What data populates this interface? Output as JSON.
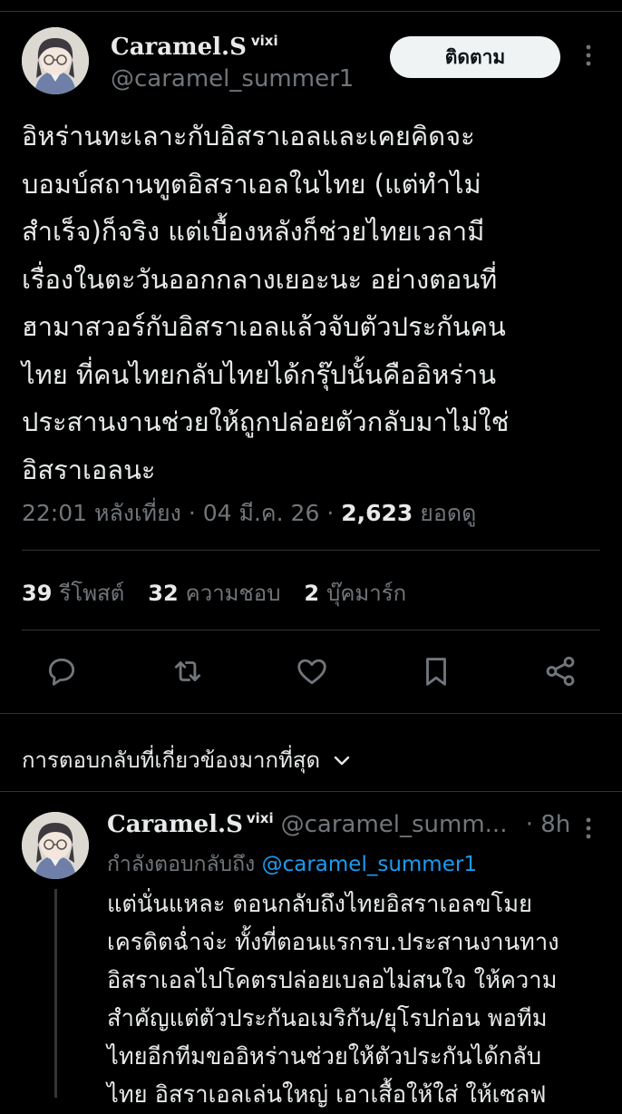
{
  "top_cut_text": "· · ·",
  "post": {
    "author": {
      "name": "Caramel.S",
      "name_suffix": "vixi",
      "handle": "@caramel_summer1"
    },
    "follow_label": "ติดตาม",
    "more_icon": "more-icon",
    "text": "อิหร่านทะเลาะกับอิสราเอลและเคยคิดจะ\nบอมบ์สถานทูตอิสราเอลในไทย (แต่ทำไม่\nสำเร็จ)ก็จริง แต่เบื้องหลังก็ช่วยไทยเวลามี\nเรื่องในตะวันออกกลางเยอะนะ อย่างตอนที่\nฮามาสวอร์กับอิสราเอลแล้วจับตัวประกันคน\nไทย ที่คนไทยกลับไทยได้กรุ๊ปนั้นคืออิหร่าน\nประสานงานช่วยให้ถูกปล่อยตัวกลับมาไม่ใช่\nอิสราเอลนะ",
    "time": "22:01 หลังเที่ยง",
    "date": "04 มี.ค. 26",
    "views_count": "2,623",
    "views_label": "ยอดดู",
    "stats": {
      "reposts_count": "39",
      "reposts_label": "รีโพสต์",
      "likes_count": "32",
      "likes_label": "ความชอบ",
      "bookmarks_count": "2",
      "bookmarks_label": "บุ๊คมาร์ก"
    },
    "actions": [
      "reply-icon",
      "repost-icon",
      "like-icon",
      "bookmark-icon",
      "share-icon"
    ]
  },
  "replies_sort_label": "การตอบกลับที่เกี่ยวข้องมากที่สุด",
  "reply": {
    "name": "Caramel.S",
    "name_suffix": "vixi",
    "handle_truncated": "@caramel_summ...",
    "time": "· 8h",
    "replying_prefix": "กำลังตอบกลับถึง",
    "replying_handle": "@caramel_summer1",
    "text": "แต่นั่นแหละ ตอนกลับถึงไทยอิสราเอลขโมย\nเครดิตฉ่ำจ่ะ ทั้งที่ตอนแรกรบ.ประสานงานทาง\nอิสราเอลไปโคตรปล่อยเบลอไม่สนใจ ให้ความ\nสำคัญแต่ตัวประกันอเมริกัน/ยุโรปก่อน พอทีม\nไทยอีกทีมขออิหร่านช่วยให้ตัวประกันได้กลับ\nไทย อิสราเอลเล่นใหญ่ เอาเสื้อให้ใส่ ให้เซลฟ"
  },
  "colors": {
    "background": "#000000",
    "text": "#e7e9ea",
    "muted": "#71767b",
    "link": "#1d9bf0",
    "divider": "#2f3336"
  }
}
